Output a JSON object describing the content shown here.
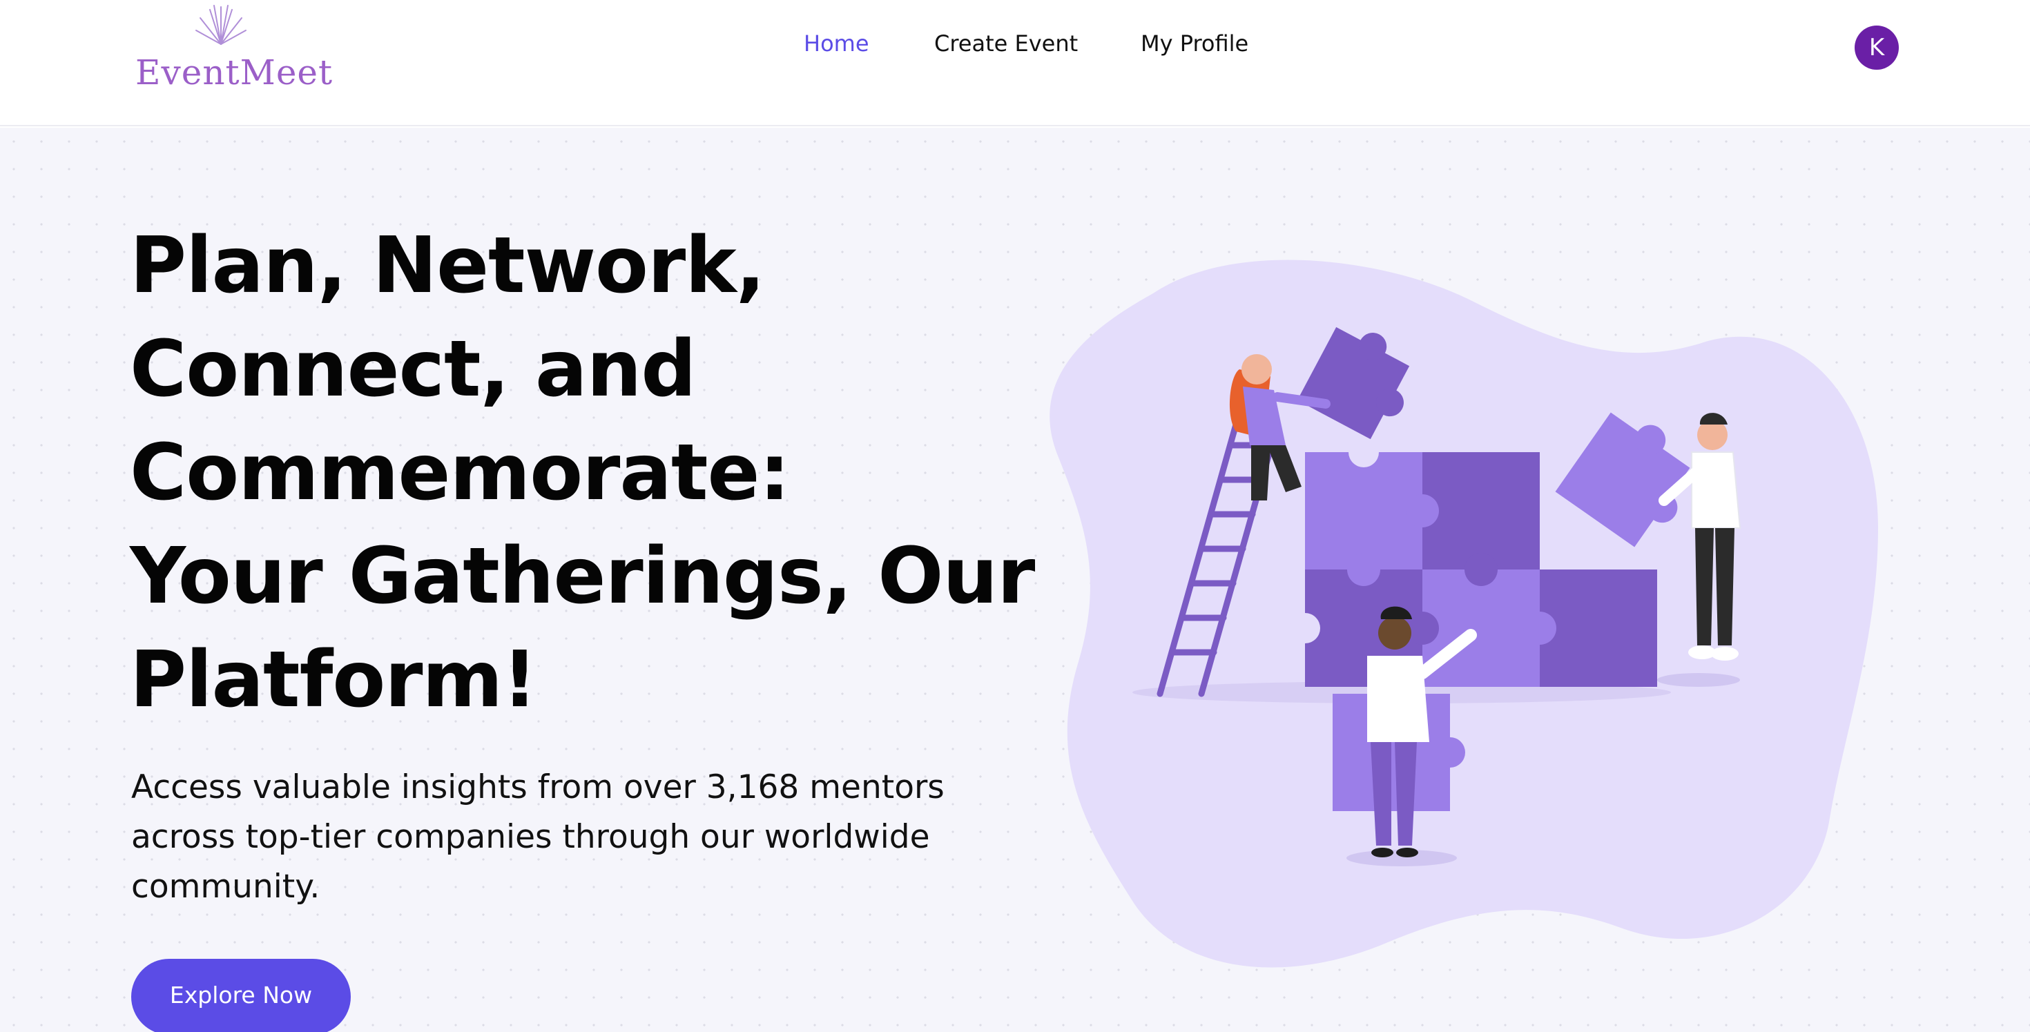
{
  "brand": {
    "logo_text": "EventMeet"
  },
  "nav": {
    "home": "Home",
    "create_event": "Create Event",
    "my_profile": "My Profile"
  },
  "user": {
    "avatar_initial": "K"
  },
  "hero": {
    "headline_lines": [
      "Plan, Network,",
      "Connect, and",
      "Commemorate:",
      "Your Gatherings, Our",
      "Platform!"
    ],
    "subtext": "Access valuable insights from over 3,168 mentors across top-tier companies through our worldwide community.",
    "cta_label": "Explore Now"
  },
  "colors": {
    "accent": "#5b4ce6",
    "avatar_bg": "#6a1fa6",
    "logo": "#9b5fc8",
    "puzzle_light": "#9b7ee8",
    "puzzle_dark": "#7b5bc4",
    "blob": "#e4ddfb"
  },
  "icons": {
    "logo_mark": "fireworks-icon",
    "illustration": "team-puzzle-illustration"
  }
}
